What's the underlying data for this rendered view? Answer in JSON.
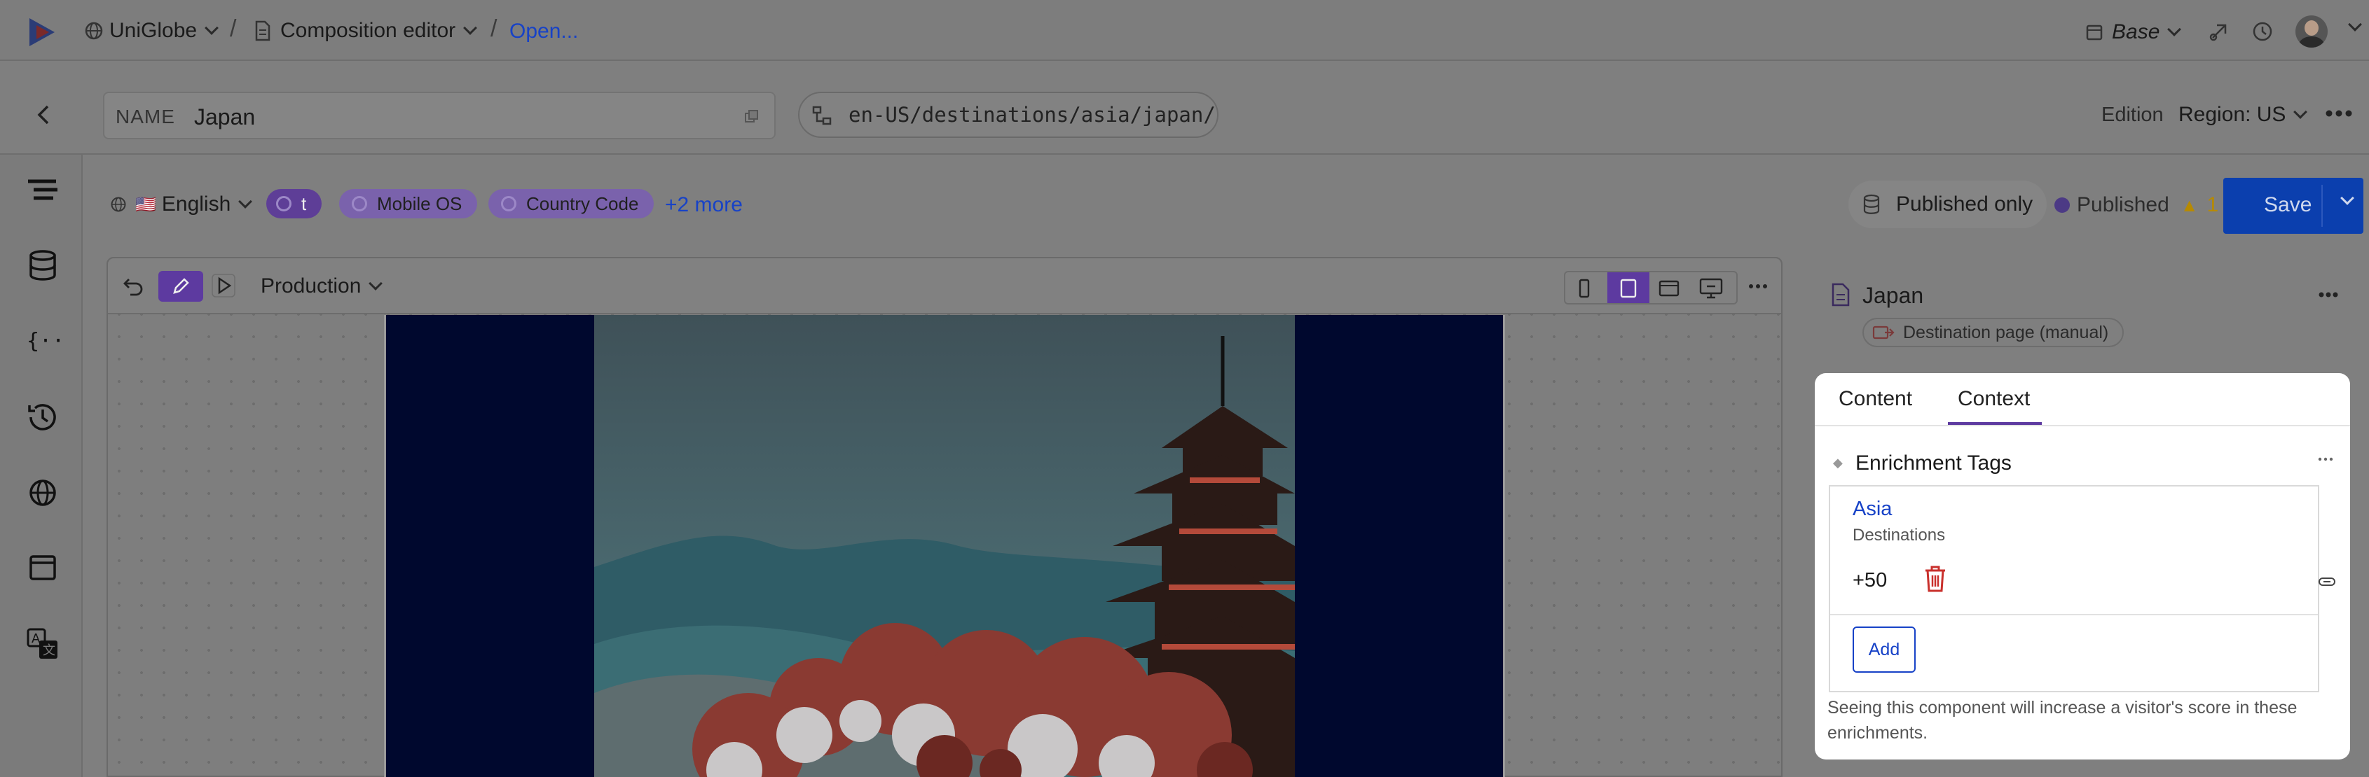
{
  "topbar": {
    "workspace": "UniGlobe",
    "section": "Composition editor",
    "open_link": "Open...",
    "theme": "Base"
  },
  "entry": {
    "name_label": "NAME",
    "name_value": "Japan",
    "path": "en-US/destinations/asia/japan/",
    "edition_label": "Edition",
    "region": "Region: US"
  },
  "locale_bar": {
    "language": "English",
    "flag": "🇺🇸",
    "pills": [
      "t",
      "Mobile OS",
      "Country Code"
    ],
    "more": "+2 more",
    "filter": "Published only",
    "status": "Published",
    "warnings": "1",
    "save_label": "Save"
  },
  "canvas": {
    "environment": "Production"
  },
  "panel": {
    "title": "Japan",
    "page_type": "Destination page (manual)",
    "tabs": [
      "Content",
      "Context"
    ],
    "active_tab": "Context",
    "section_title": "Enrichment Tags",
    "tag": {
      "name": "Asia",
      "category": "Destinations",
      "score": "+50"
    },
    "add_label": "Add",
    "help_text_line1": "Seeing this component will increase a visitor's score in these",
    "help_text_line2": "enrichments."
  },
  "colors": {
    "accent": "#0b3fae",
    "link": "#1742c7",
    "pill": "#5e3e97",
    "danger": "#c9302c",
    "preview_bg": "#00082e"
  },
  "icons": [
    "logo-icon",
    "globe-icon",
    "document-icon",
    "calendar-icon",
    "compare-icon",
    "history-icon",
    "avatar",
    "back-arrow-icon",
    "copy-icon",
    "tree-icon",
    "more-icon",
    "outline-icon",
    "database-icon",
    "variables-icon",
    "clock-icon",
    "web-icon",
    "browser-icon",
    "translate-icon",
    "undo-icon",
    "edit-icon",
    "play-icon",
    "mobile-icon",
    "tablet-icon",
    "desktop-icon",
    "wide-icon",
    "trash-icon",
    "link-icon"
  ]
}
